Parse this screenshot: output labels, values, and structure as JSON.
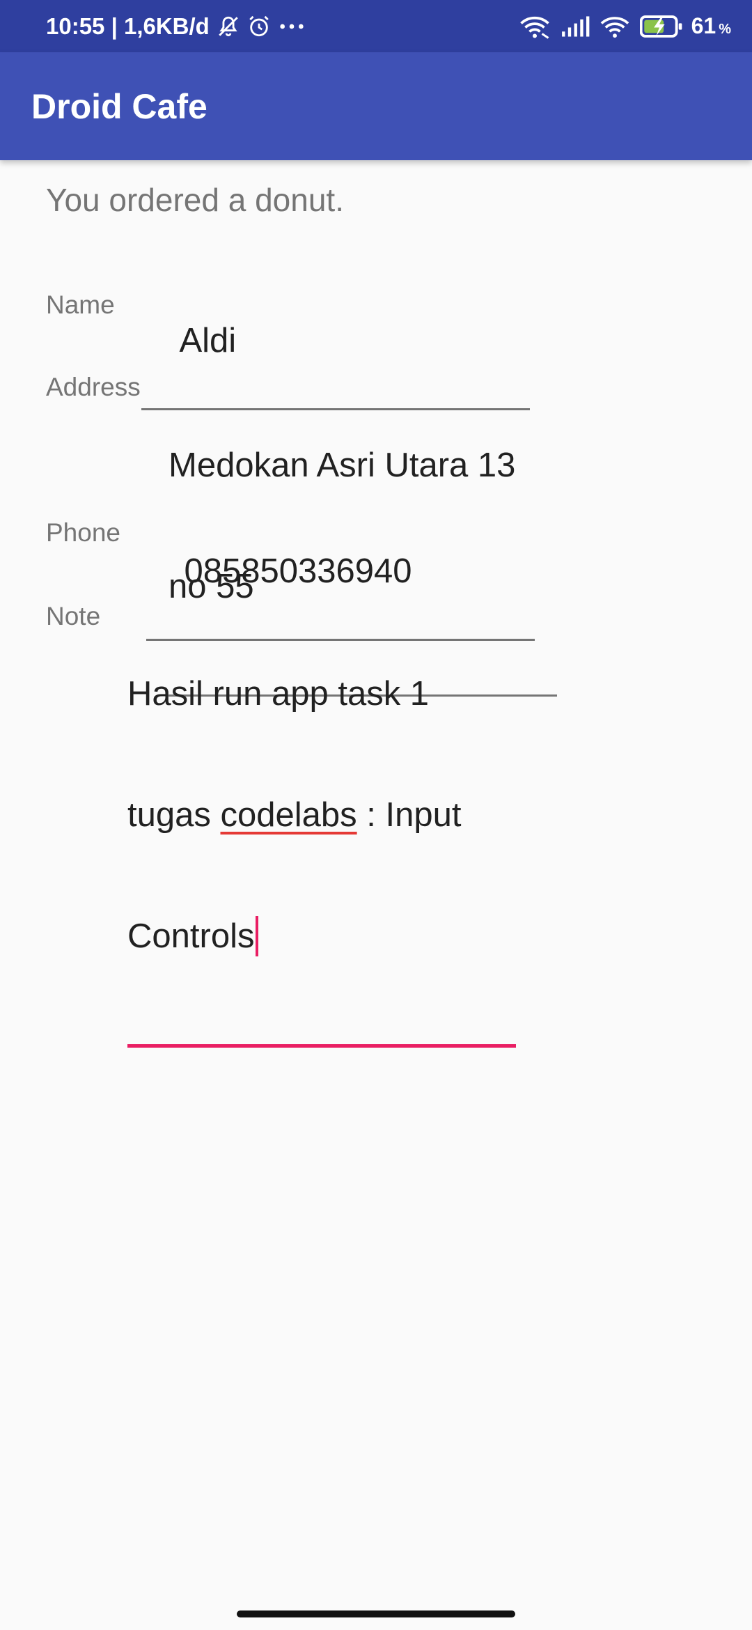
{
  "status_bar": {
    "time_and_speed": "10:55 | 1,6KB/d",
    "battery_percent": "61",
    "battery_unit": "%",
    "icons": [
      "mute-alarm-icon",
      "alarm-icon",
      "more-dots-icon",
      "wifi-assist-icon",
      "signal-icon",
      "wifi-icon",
      "battery-charging-icon"
    ]
  },
  "app_bar": {
    "title": "Droid Cafe"
  },
  "content": {
    "order_message": "You ordered a donut.",
    "name": {
      "label": "Name",
      "value": "Aldi"
    },
    "address": {
      "label": "Address",
      "value_line1": "Medokan Asri Utara 13",
      "value_line2": "no 55"
    },
    "phone": {
      "label": "Phone",
      "value": "085850336940"
    },
    "note": {
      "label": "Note",
      "line1": "Hasil run app task 1",
      "line2_prefix": "tugas ",
      "line2_misspelled": "codelabs",
      "line2_suffix": " : Input",
      "line3": "Controls"
    }
  },
  "colors": {
    "status_bar": "#2f3f9f",
    "app_bar": "#3f51b5",
    "accent": "#e91e63",
    "background": "#fafafa"
  }
}
